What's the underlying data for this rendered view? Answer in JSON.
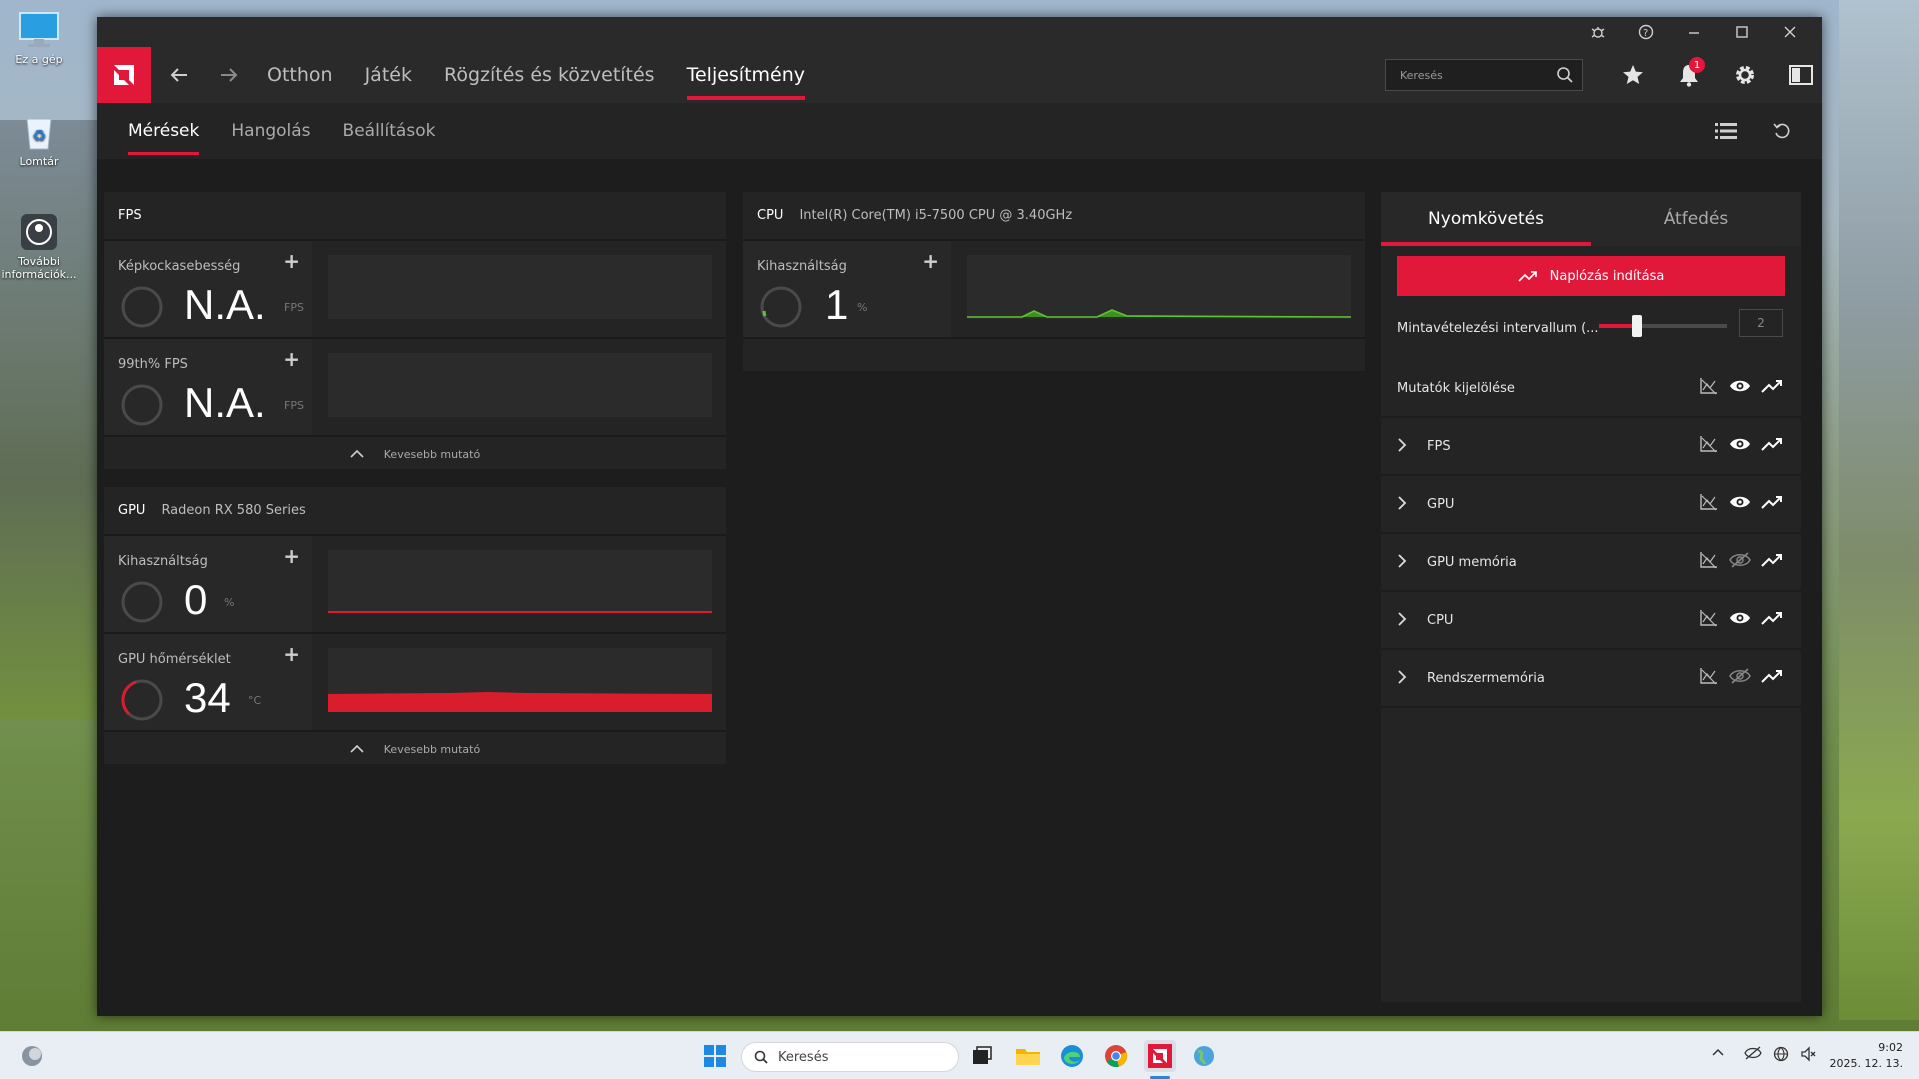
{
  "desktop": {
    "icons": [
      {
        "label": "Ez a gép"
      },
      {
        "label": "Lomtár"
      },
      {
        "label": "További információk..."
      }
    ]
  },
  "topnav": {
    "items": [
      "Otthon",
      "Játék",
      "Rögzítés és közvetítés",
      "Teljesítmény"
    ],
    "active": "Teljesítmény",
    "search_placeholder": "Keresés",
    "notification_count": "1"
  },
  "subnav": {
    "items": [
      "Mérések",
      "Hangolás",
      "Beállítások"
    ],
    "active": "Mérések"
  },
  "fps_panel": {
    "title": "FPS",
    "metrics": [
      {
        "label": "Képkockasebesség",
        "value": "N.A.",
        "unit": "FPS"
      },
      {
        "label": "99th% FPS",
        "value": "N.A.",
        "unit": "FPS"
      }
    ],
    "footer": "Kevesebb mutató"
  },
  "gpu_panel": {
    "title": "GPU",
    "subtitle": "Radeon RX 580 Series",
    "metrics": [
      {
        "label": "Kihasználtság",
        "value": "0",
        "unit": "%"
      },
      {
        "label": "GPU hőmérséklet",
        "value": "34",
        "unit": "°C"
      }
    ],
    "footer": "Kevesebb mutató"
  },
  "cpu_panel": {
    "title": "CPU",
    "subtitle": "Intel(R) Core(TM) i5-7500 CPU @ 3.40GHz",
    "metrics": [
      {
        "label": "Kihasználtság",
        "value": "1",
        "unit": "%"
      }
    ]
  },
  "right_panel": {
    "tabs": [
      "Nyomkövetés",
      "Átfedés"
    ],
    "active_tab": "Nyomkövetés",
    "log_button": "Naplózás indítása",
    "interval_label": "Mintavételezési intervallum (...",
    "interval_value": "2",
    "interval_fraction": 0.3,
    "metrics_select_label": "Mutatók kijelölése",
    "groups": [
      {
        "label": "FPS",
        "visible": true
      },
      {
        "label": "GPU",
        "visible": true
      },
      {
        "label": "GPU memória",
        "visible": false
      },
      {
        "label": "CPU",
        "visible": true
      },
      {
        "label": "Rendszermemória",
        "visible": false
      }
    ]
  },
  "taskbar": {
    "search_placeholder": "Keresés",
    "time": "9:02",
    "date": "2025. 12. 13."
  },
  "colors": {
    "accent": "#e2183a",
    "cpu_graph": "#5fc531",
    "gpu_graph": "#d81e2c"
  }
}
